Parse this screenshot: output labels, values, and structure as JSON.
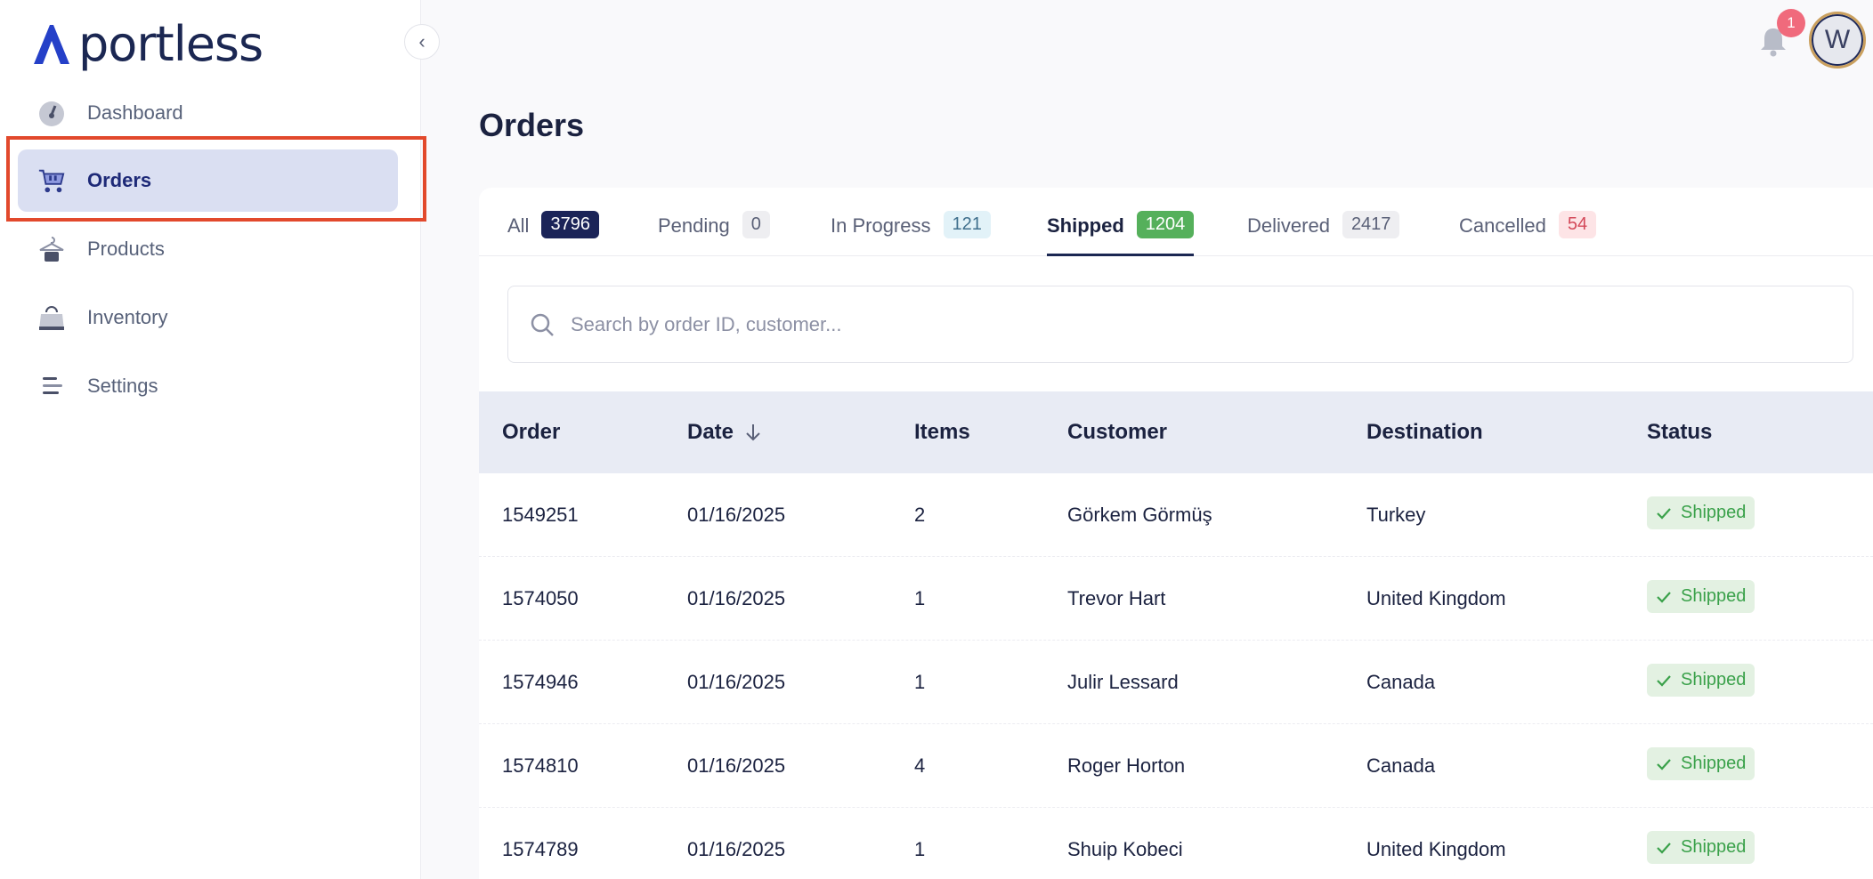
{
  "brand": {
    "name": "portless"
  },
  "sidebar": {
    "items": [
      {
        "label": "Dashboard",
        "icon": "gauge-icon"
      },
      {
        "label": "Orders",
        "icon": "cart-icon",
        "active": true
      },
      {
        "label": "Products",
        "icon": "hanger-icon"
      },
      {
        "label": "Inventory",
        "icon": "bag-icon"
      },
      {
        "label": "Settings",
        "icon": "sliders-icon"
      }
    ]
  },
  "header": {
    "notification_count": "1",
    "avatar_initial": "W"
  },
  "page": {
    "title": "Orders"
  },
  "tabs": [
    {
      "label": "All",
      "count": "3796",
      "bg": "#1b2458",
      "fg": "#ffffff"
    },
    {
      "label": "Pending",
      "count": "0",
      "bg": "#eeeef1",
      "fg": "#5a6077"
    },
    {
      "label": "In Progress",
      "count": "121",
      "bg": "#e2f2f8",
      "fg": "#3f6f8c"
    },
    {
      "label": "Shipped",
      "count": "1204",
      "bg": "#55b05b",
      "fg": "#ffffff",
      "active": true
    },
    {
      "label": "Delivered",
      "count": "2417",
      "bg": "#eeeef1",
      "fg": "#5a6077"
    },
    {
      "label": "Cancelled",
      "count": "54",
      "bg": "#fde4e6",
      "fg": "#d44a5a"
    }
  ],
  "search": {
    "placeholder": "Search by order ID, customer..."
  },
  "table": {
    "columns": [
      "Order",
      "Date",
      "Items",
      "Customer",
      "Destination",
      "Status"
    ],
    "rows": [
      {
        "order": "1549251",
        "date": "01/16/2025",
        "items": "2",
        "customer": "Görkem Görmüş",
        "destination": "Turkey",
        "status": "Shipped"
      },
      {
        "order": "1574050",
        "date": "01/16/2025",
        "items": "1",
        "customer": "Trevor Hart",
        "destination": "United Kingdom",
        "status": "Shipped"
      },
      {
        "order": "1574946",
        "date": "01/16/2025",
        "items": "1",
        "customer": "Julir Lessard",
        "destination": "Canada",
        "status": "Shipped"
      },
      {
        "order": "1574810",
        "date": "01/16/2025",
        "items": "4",
        "customer": "Roger Horton",
        "destination": "Canada",
        "status": "Shipped"
      },
      {
        "order": "1574789",
        "date": "01/16/2025",
        "items": "1",
        "customer": "Shuip Kobeci",
        "destination": "United Kingdom",
        "status": "Shipped"
      }
    ]
  },
  "colors": {
    "accent": "#1b2752",
    "highlight": "#e2492c",
    "shipped": "#3aa14a"
  }
}
